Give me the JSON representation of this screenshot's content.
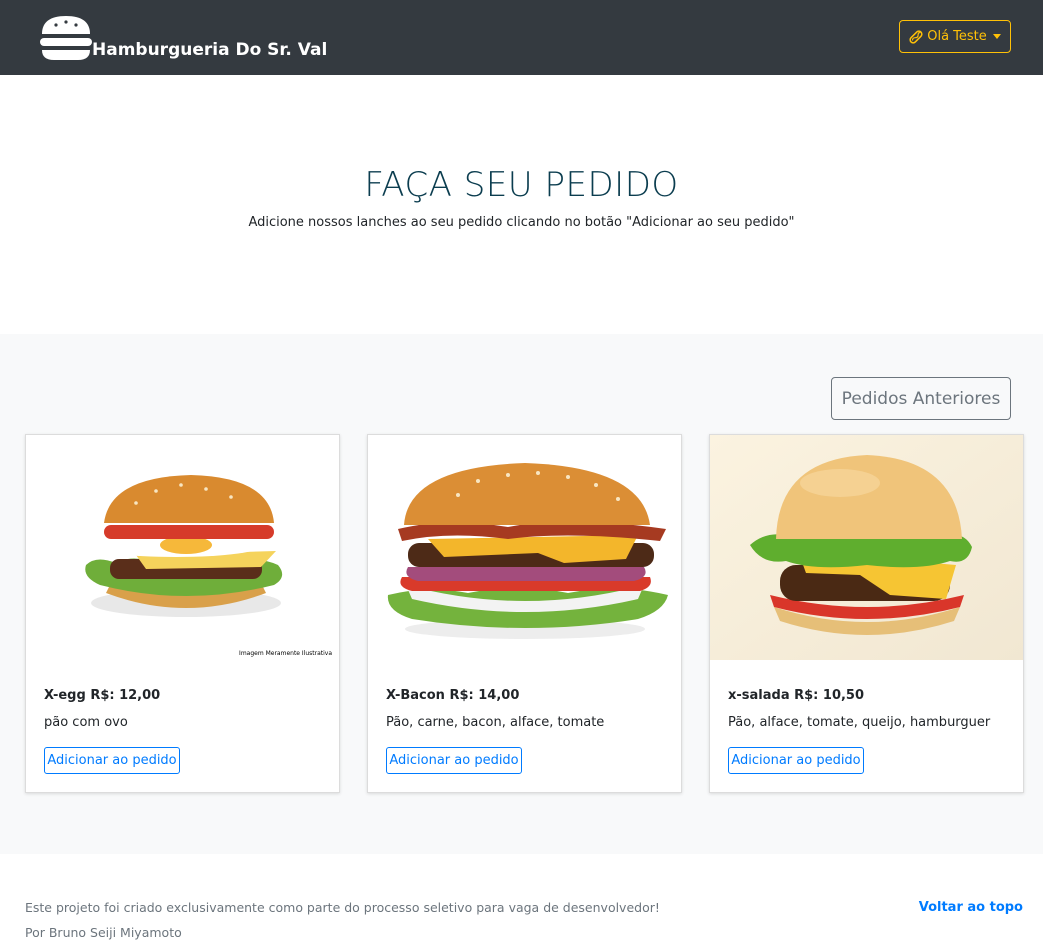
{
  "navbar": {
    "brand": "Hamburgueria Do Sr. Val",
    "user_menu_label": "Olá Teste",
    "colors": {
      "background": "#343a40",
      "accent": "#ffc107"
    }
  },
  "hero": {
    "title": "FAÇA SEU PEDIDO",
    "subtitle": "Adicione nossos lanches ao seu pedido clicando no botão \"Adicionar ao seu pedido\""
  },
  "menu": {
    "previous_orders_label": "Pedidos Anteriores",
    "items": [
      {
        "title": "X-egg R$: 12,00",
        "description": "pão com ovo",
        "button_label": "Adicionar ao pedido",
        "image_caption": "Imagem Meramente Ilustrativa"
      },
      {
        "title": "X-Bacon R$: 14,00",
        "description": "Pão, carne, bacon, alface, tomate",
        "button_label": "Adicionar ao pedido"
      },
      {
        "title": "x-salada R$: 10,50",
        "description": "Pão, alface, tomate, queijo, hamburguer",
        "button_label": "Adicionar ao pedido"
      }
    ]
  },
  "footer": {
    "line1": "Este projeto foi criado exclusivamente como parte do processo seletivo para vaga de desenvolvedor!",
    "line2": "Por Bruno Seiji Miyamoto",
    "back_to_top": "Voltar ao topo"
  }
}
